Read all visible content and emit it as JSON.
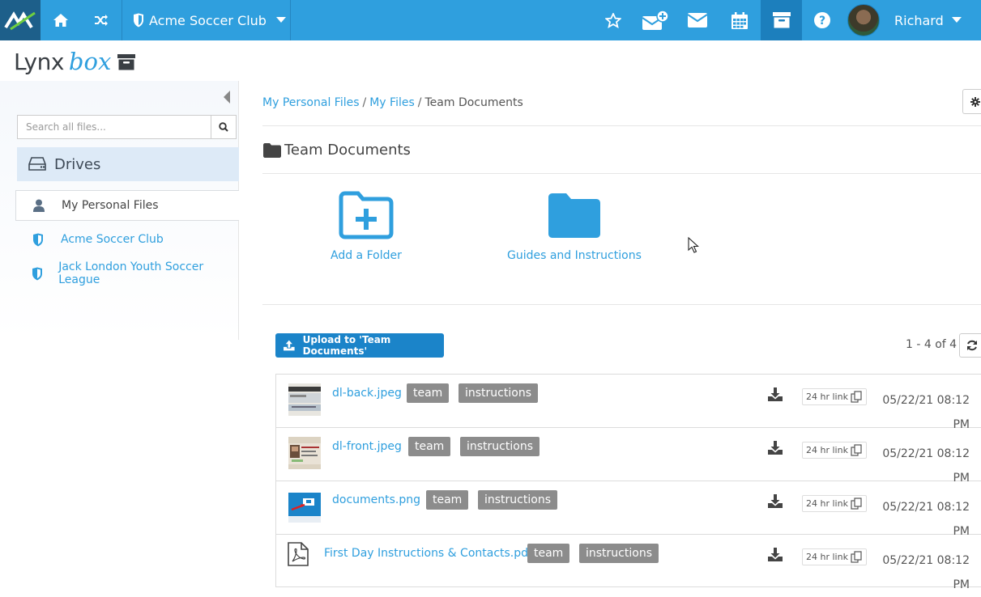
{
  "topbar": {
    "club_name": "Acme Soccer Club",
    "user_name": "Richard",
    "accent": "#2f9fde",
    "icons": [
      "logo-icon",
      "home-icon",
      "shuffle-icon",
      "shield-icon",
      "star-icon",
      "compose-mail-icon",
      "mail-icon",
      "calendar-icon",
      "archive-icon",
      "help-icon",
      "avatar"
    ]
  },
  "brand": {
    "part1": "Lynx",
    "part2": "box"
  },
  "sidebar": {
    "search_placeholder": "Search all files...",
    "drives_label": "Drives",
    "items": [
      {
        "label": "My Personal Files",
        "icon": "user-icon",
        "active": true
      },
      {
        "label": "Acme Soccer Club",
        "icon": "shield-icon",
        "active": false
      },
      {
        "label": "Jack London Youth Soccer League",
        "icon": "shield-icon",
        "active": false
      }
    ]
  },
  "breadcrumb": {
    "items": [
      "My Personal Files",
      "My Files"
    ],
    "current": "Team Documents",
    "separator": "/"
  },
  "folder": {
    "title": "Team Documents",
    "tiles": [
      {
        "label": "Add a Folder",
        "icon": "folder-plus-icon"
      },
      {
        "label": "Guides and Instructions",
        "icon": "folder-icon"
      }
    ]
  },
  "files": {
    "upload_label": "Upload to 'Team Documents'",
    "pager": "1 - 4 of 4",
    "link_label": "24 hr link",
    "rows": [
      {
        "name": "dl-back.jpeg",
        "tags": [
          "team",
          "instructions"
        ],
        "date": "05/22/21 08:12",
        "time_suffix": "PM",
        "thumb": "image-thumb"
      },
      {
        "name": "dl-front.jpeg",
        "tags": [
          "team",
          "instructions"
        ],
        "date": "05/22/21 08:12",
        "time_suffix": "PM",
        "thumb": "image-thumb"
      },
      {
        "name": "documents.png",
        "tags": [
          "team",
          "instructions"
        ],
        "date": "05/22/21 08:12",
        "time_suffix": "PM",
        "thumb": "image-thumb"
      },
      {
        "name": "First Day Instructions & Contacts.pdf",
        "tags": [
          "team",
          "instructions"
        ],
        "date": "05/22/21 08:12",
        "time_suffix": "PM",
        "thumb": "pdf-icon"
      }
    ]
  }
}
